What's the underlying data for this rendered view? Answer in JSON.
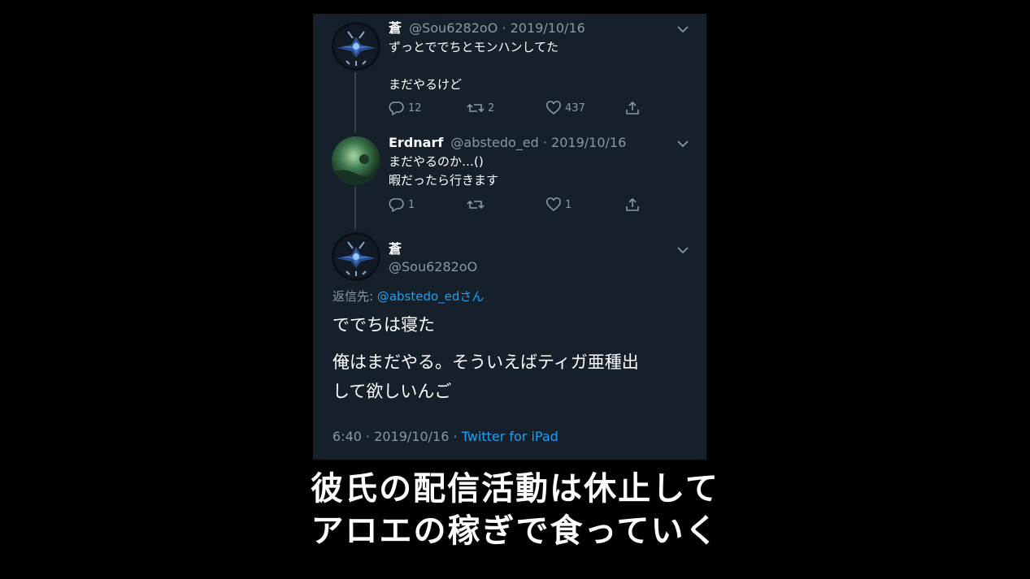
{
  "thread": [
    {
      "name": "蒼",
      "handle": "@Sou6282oO",
      "sep": "·",
      "date": "2019/10/16",
      "lines": [
        "ずっとででちとモンハンしてた",
        "",
        "まだやるけど"
      ],
      "replies": "12",
      "retweets": "2",
      "likes": "437",
      "avatar": "dark-dragon-emblem"
    },
    {
      "name": "Erdnarf",
      "handle": "@abstedo_ed",
      "sep": "·",
      "date": "2019/10/16",
      "lines": [
        "まだやるのか…()",
        "暇だったら行きます"
      ],
      "replies": "1",
      "retweets": "",
      "likes": "1",
      "avatar": "green-scene"
    }
  ],
  "main_tweet": {
    "name": "蒼",
    "handle": "@Sou6282oO",
    "reply_prefix": "返信先: ",
    "reply_mention": "@abstedo_edさん",
    "lines": [
      "ででちは寝た",
      "俺はまだやる。そういえばティガ亜種出",
      "して欲しいんご"
    ],
    "time": "6:40 · 2019/10/16 · ",
    "source": "Twitter for iPad"
  },
  "caption": {
    "line1": "彼氏の配信活動は休止して",
    "line2": "アロエの稼ぎで食っていく"
  },
  "colors": {
    "card_bg": "#15202b",
    "muted": "#8899a6",
    "link": "#1da1f2",
    "page_bg": "#000000"
  }
}
